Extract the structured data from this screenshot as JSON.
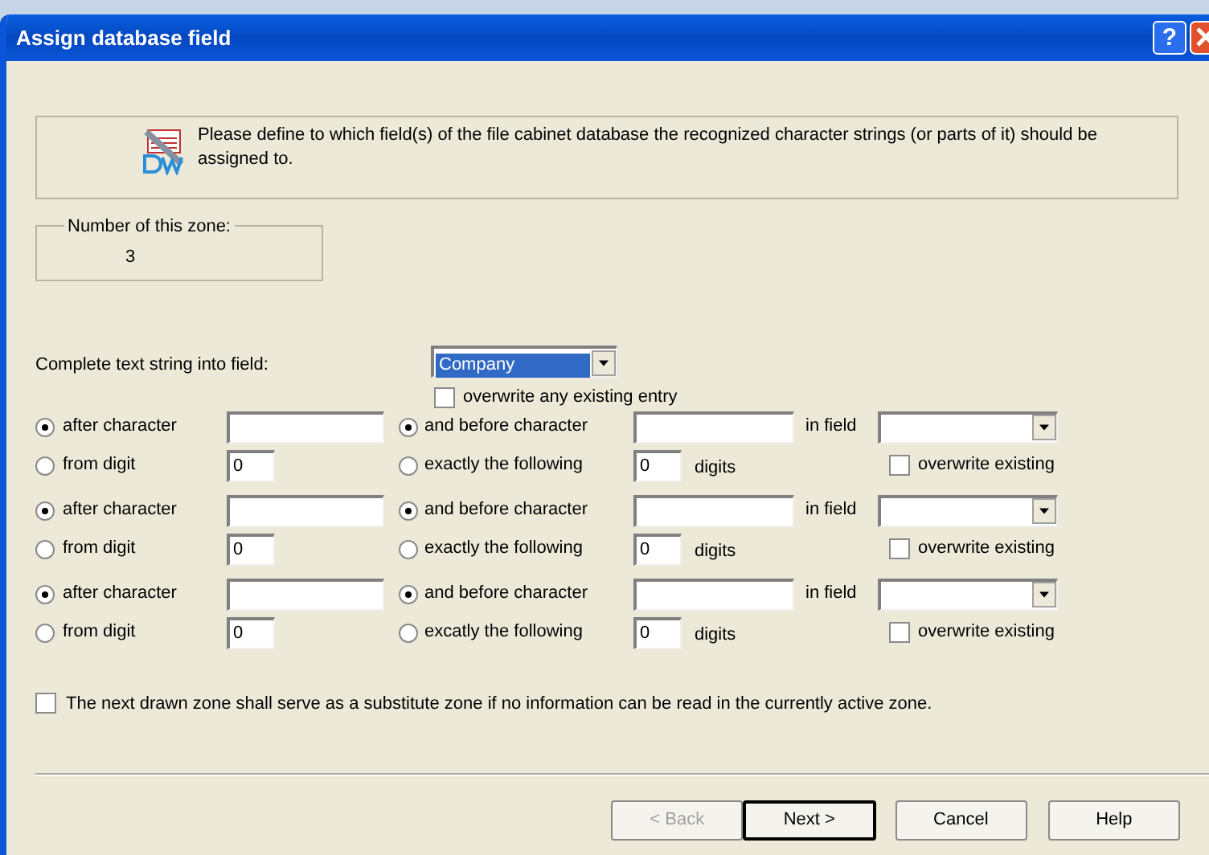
{
  "window": {
    "title": "Assign database field",
    "help_glyph": "?"
  },
  "info": {
    "text": "Please define to which field(s) of the file cabinet database the recognized character strings (or parts of it) should be assigned to."
  },
  "zone_number": {
    "label": "Number of this zone:",
    "value": "3"
  },
  "complete_field": {
    "label": "Complete text string into field:",
    "value": "Company",
    "overwrite": {
      "label": "overwrite any existing entry",
      "checked": false
    }
  },
  "rules": [
    {
      "after_character": {
        "label": "after character",
        "selected": true
      },
      "from_digit": {
        "label": "from digit",
        "selected": false,
        "value": "0"
      },
      "before_character": {
        "label": "and before character",
        "selected": true
      },
      "exactly": {
        "label": "exactly the following",
        "selected": false,
        "value": "0",
        "unit": "digits"
      },
      "field_label": "in field",
      "overwrite": {
        "label": "overwrite existing",
        "checked": false
      }
    },
    {
      "after_character": {
        "label": "after character",
        "selected": true
      },
      "from_digit": {
        "label": "from digit",
        "selected": false,
        "value": "0"
      },
      "before_character": {
        "label": "and before character",
        "selected": true
      },
      "exactly": {
        "label": "exactly the following",
        "selected": false,
        "value": "0",
        "unit": "digits"
      },
      "field_label": "in field",
      "overwrite": {
        "label": "overwrite existing",
        "checked": false
      }
    },
    {
      "after_character": {
        "label": "after character",
        "selected": true
      },
      "from_digit": {
        "label": "from digit",
        "selected": false,
        "value": "0"
      },
      "before_character": {
        "label": "and before character",
        "selected": true
      },
      "exactly": {
        "label": "excatly the following",
        "selected": false,
        "value": "0",
        "unit": "digits"
      },
      "field_label": "in field",
      "overwrite": {
        "label": "overwrite existing",
        "checked": false
      }
    }
  ],
  "substitute": {
    "label": "The next drawn zone shall serve as a substitute zone if no information can be read in the currently active zone.",
    "checked": false
  },
  "buttons": [
    {
      "label": "< Back",
      "disabled": true,
      "default": false
    },
    {
      "label": "Next >",
      "disabled": false,
      "default": true
    },
    {
      "label": "Cancel",
      "disabled": false,
      "default": false
    },
    {
      "label": "Help",
      "disabled": false,
      "default": false
    }
  ]
}
